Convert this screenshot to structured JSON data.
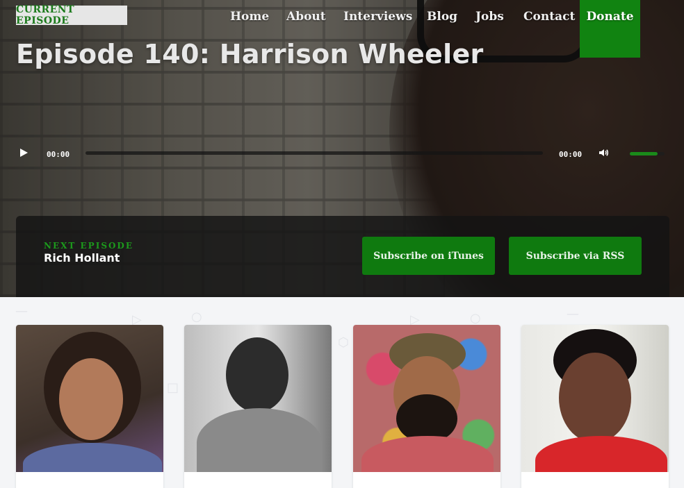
{
  "badge": "CURRENT EPISODE",
  "nav": {
    "items": [
      "Home",
      "About",
      "Interviews",
      "Blog",
      "Jobs",
      "Contact"
    ],
    "donate": "Donate"
  },
  "episode": {
    "title": "Episode 140: Harrison Wheeler"
  },
  "player": {
    "current_time": "00:00",
    "duration": "00:00",
    "volume_fraction": 0.8
  },
  "next_episode": {
    "label": "NEXT EPISODE",
    "name": "Rich Hollant"
  },
  "subscribe": {
    "itunes": "Subscribe on iTunes",
    "rss": "Subscribe via RSS"
  },
  "colors": {
    "accent_green": "#118311",
    "dark_bar": "#141414",
    "page_bg": "#f4f5f7"
  },
  "guest_cards": [
    {
      "icon": "guest-photo-1"
    },
    {
      "icon": "guest-photo-2"
    },
    {
      "icon": "guest-photo-3"
    },
    {
      "icon": "guest-photo-4"
    }
  ]
}
